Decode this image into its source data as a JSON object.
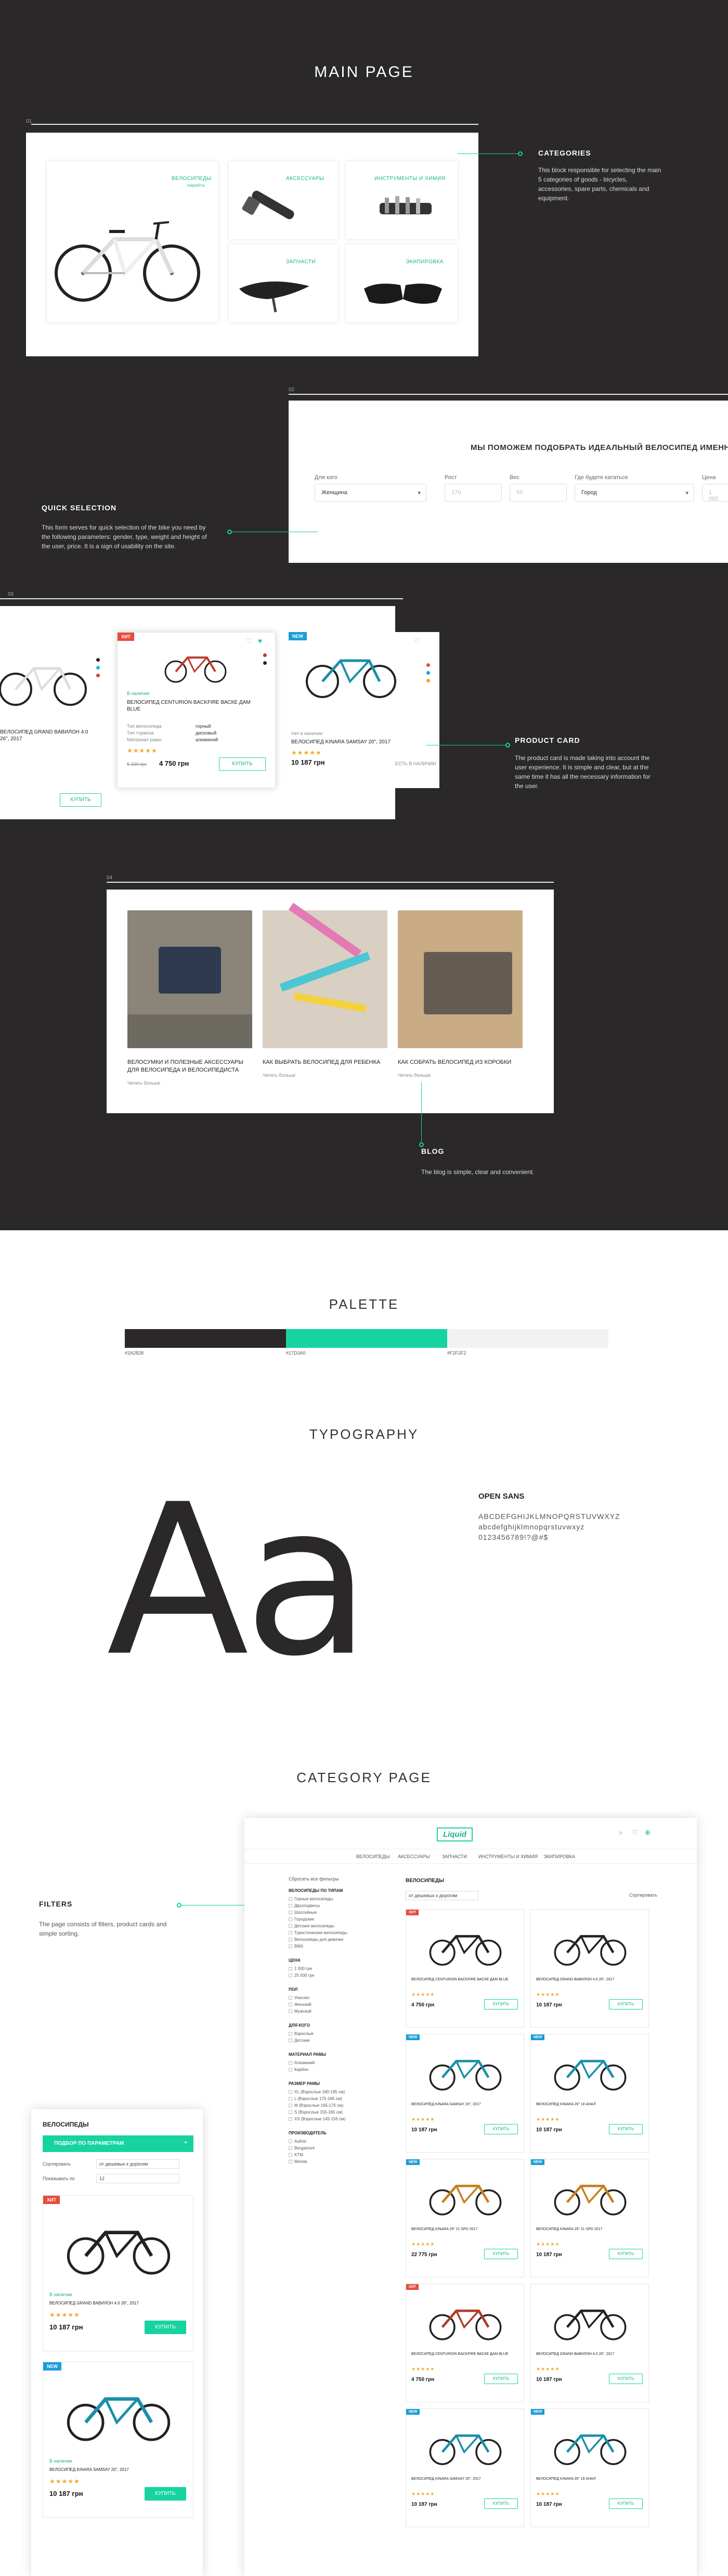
{
  "colors": {
    "dark": "#2a2828",
    "accent": "#17d3a0",
    "light": "#f2f2f2"
  },
  "main_page": {
    "title": "MAIN PAGE",
    "rule_numbers": [
      "01",
      "02",
      "03",
      "04"
    ],
    "categories_note": {
      "title": "CATEGORIES",
      "text": "This block responsible for selecting the main 5 categories of goods - bicycles, accessories, spare parts, chemicals and equipment."
    },
    "categories": [
      {
        "label": "ВЕЛОСИПЕДЫ",
        "sub": "перейти",
        "icon": "bike-icon"
      },
      {
        "label": "АКСЕССУАРЫ",
        "icon": "pump-icon"
      },
      {
        "label": "ИНСТРУМЕНТЫ И ХИМИЯ",
        "icon": "tool-icon"
      },
      {
        "label": "ЗАПЧАСТИ",
        "icon": "saddle-icon"
      },
      {
        "label": "ЭКИПИРОВКА",
        "icon": "glasses-icon"
      }
    ],
    "quick_selection_note": {
      "title": "QUICK SELECTION",
      "text": "This form serves for quick selection of the bike you need by the following parameters: gender, type, weight and height of the user, price. It is a sign of usability on the site."
    },
    "quick_form": {
      "title": "МЫ ПОМОЖЕМ ПОДОБРАТЬ ИДЕАЛЬНЫЙ ВЕЛОСИПЕД ИМЕННО ДЛ",
      "fields": [
        {
          "label": "Для кого",
          "value": "Женщина"
        },
        {
          "label": "Рост",
          "value": "170"
        },
        {
          "label": "Вес",
          "value": "50"
        },
        {
          "label": "Где будете кататься",
          "value": "Город"
        },
        {
          "label": "Цена",
          "value": "1 000"
        }
      ]
    },
    "product_card_note": {
      "title": "PRODUCT CARD",
      "text": "The product card is made taking into account the user experience. It is simple and clear, but at the same time it has all the necessary information for the user."
    },
    "product_cards": [
      {
        "badge": "",
        "name": "ВЕЛОСИПЕД GRAND ВАВИЛОН 4.0 26\", 2017",
        "price": "",
        "button": "КУПИТЬ"
      },
      {
        "badge": "ХИТ",
        "name": "ВЕЛОСИПЕД CENTURION BACKFIRE ВАСКЕ ДАМ BLUE",
        "stock": "В наличии",
        "specs": [
          "Тип велосипеда",
          "Тип тормоза",
          "Материал рамы"
        ],
        "spec_values": [
          "горный",
          "дисковый",
          "алюминий"
        ],
        "price": "4 750 грн",
        "old_price": "5 100 грн",
        "button": "КУПИТЬ"
      },
      {
        "badge": "NEW",
        "name": "ВЕЛОСИПЕД KINARA SAMSAY 20\", 2017",
        "stock": "Нет в наличии",
        "price": "10 187 грн",
        "button": "ЕСТЬ В НАЛИЧИИ"
      }
    ],
    "blog_note": {
      "title": "BLOG",
      "text": "The blog is simple, clear and convenient."
    },
    "blog_posts": [
      {
        "title": "ВЕЛОСУМКИ И ПОЛЕЗНЫЕ АКСЕССУАРЫ ДЛЯ ВЕЛОСИПЕДА И ВЕЛОСИПЕДИСТА",
        "more": "Читать больше"
      },
      {
        "title": "КАК ВЫБРАТЬ ВЕЛОСИПЕД ДЛЯ РЕБЕНКА",
        "more": "Читать больше"
      },
      {
        "title": "КАК СОБРАТЬ ВЕЛОСИПЕД ИЗ КОРОБКИ",
        "more": "Читать больше"
      }
    ]
  },
  "palette": {
    "title": "PALETTE",
    "swatches": [
      {
        "label": "#2A2828",
        "color": "#2a2828"
      },
      {
        "label": "#17D3A0",
        "color": "#17d3a0"
      },
      {
        "label": "#F2F2F2",
        "color": "#f2f2f2"
      }
    ]
  },
  "typography": {
    "title": "TYPOGRAPHY",
    "sample": "Aa",
    "font_name": "OPEN SANS",
    "upper": "ABCDEFGHIJKLMNOPQRSTUVWXYZ",
    "lower": "abcdefghijklmnopqrstuvwxyz",
    "digits": "0123456789!?@#$"
  },
  "category_page": {
    "title": "CATEGORY PAGE",
    "filters_note": {
      "title": "FILTERS",
      "text": "The page consists of filters, product cards and simple sorting."
    },
    "logo": "Liquid",
    "nav": [
      "ВЕЛОСИПЕДЫ",
      "АКСЕССУАРЫ",
      "ЗАПЧАСТИ",
      "ИНСТРУМЕНТЫ И ХИМИЯ",
      "ЭКИПИРОВКА"
    ],
    "heading": "ВЕЛОСИПЕДЫ",
    "reset": "Сбросить все фильтры",
    "filter_groups": [
      {
        "title": "ВЕЛОСИПЕДЫ ПО ТИПАМ",
        "items": [
          "Горные велосипеды",
          "Двухподвесы",
          "Шоссейные",
          "Городские",
          "Детские велосипеды",
          "Туристические велосипеды",
          "Велосипеды для девочек",
          "BMX"
        ]
      },
      {
        "title": "ЦЕНА",
        "items": [
          "1 000 грн",
          "25 000 грн"
        ]
      },
      {
        "title": "ПОЛ",
        "items": [
          "Унисекс",
          "Женский",
          "Мужской"
        ]
      },
      {
        "title": "ДЛЯ КОГО",
        "items": [
          "Взрослые",
          "Детские"
        ]
      },
      {
        "title": "МАТЕРИАЛ РАМЫ",
        "items": [
          "Алюминий",
          "Карбон"
        ]
      },
      {
        "title": "РАЗМЕР РАМЫ",
        "items": [
          "XL (Взрослые 180-195 см)",
          "L (Взрослые 175-185 см)",
          "M (Взрослые 165-175 см)",
          "S (Взрослые 155-165 см)",
          "XS (Взрослые 145-155 см)"
        ]
      },
      {
        "title": "ПРОИЗВОДИТЕЛЬ",
        "items": [
          "Author",
          "Bergamont",
          "KTM",
          "Merida"
        ]
      }
    ],
    "sort_label": "Сортировать",
    "sort_value": "от дешевых к дорогим",
    "products": [
      {
        "badge": "ХИТ",
        "name": "ВЕЛОСИПЕД CENTURION BACKFIRE ВАСКЕ ДАМ BLUE",
        "price": "4 750 грн",
        "frame": "#222"
      },
      {
        "badge": "",
        "name": "ВЕЛОСИПЕД GRAND ВАВИЛОН 4.0 26\", 2017",
        "price": "10 187 грн",
        "frame": "#222"
      },
      {
        "badge": "NEW",
        "name": "ВЕЛОСИПЕД KINARA SAMSAY 20\", 2017",
        "price": "10 187 грн",
        "frame": "#1a8fa8"
      },
      {
        "badge": "NEW",
        "name": "ВЕЛОСИПЕД KINARA 26\" 18 АНАЛ",
        "price": "10 187 грн",
        "frame": "#1a8fa8"
      },
      {
        "badge": "NEW",
        "name": "ВЕЛОСИПЕД KINARA 29\" 21 SPD 2017",
        "price": "22 775 грн",
        "frame": "#c77f1a"
      },
      {
        "badge": "NEW",
        "name": "ВЕЛОСИПЕД KINARA 29\" 21 SPD 2017",
        "price": "10 187 грн",
        "frame": "#c77f1a"
      },
      {
        "badge": "ХИТ",
        "name": "ВЕЛОСИПЕД CENTURION BACKFIRE ВАСКЕ ДАМ BLUE",
        "price": "4 750 грн",
        "frame": "#b13a2a"
      },
      {
        "badge": "",
        "name": "ВЕЛОСИПЕД GRAND ВАВИЛОН 4.0 26\", 2017",
        "price": "10 187 грн",
        "frame": "#222"
      },
      {
        "badge": "NEW",
        "name": "ВЕЛОСИПЕД KINARA SAMSAY 20\", 2017",
        "price": "10 187 грн",
        "frame": "#1a8fa8"
      },
      {
        "badge": "NEW",
        "name": "ВЕЛОСИПЕД KINARA 26\" 18 АНАЛ",
        "price": "10 187 грн",
        "frame": "#1a8fa8"
      }
    ],
    "buy": "КУПИТЬ",
    "mobile": {
      "heading": "ВЕЛОСИПЕДЫ",
      "filter_btn": "ПОДБОР ПО ПАРАМЕТРАМ",
      "sort_label": "Сортировать",
      "sort_value": "от дешевых к дорогим",
      "show_label": "Показывать по",
      "show_value": "12",
      "products": [
        {
          "badge": "ХИТ",
          "name": "ВЕЛОСИПЕД GRAND ВАВИЛОН 4.0 26\", 2017",
          "price": "10 187 грн",
          "stock": "В наличии"
        },
        {
          "badge": "NEW",
          "name": "ВЕЛОСИПЕД KINARA SAMSAY 20\", 2017",
          "price": "10 187 грн",
          "stock": "В наличии"
        }
      ]
    }
  }
}
